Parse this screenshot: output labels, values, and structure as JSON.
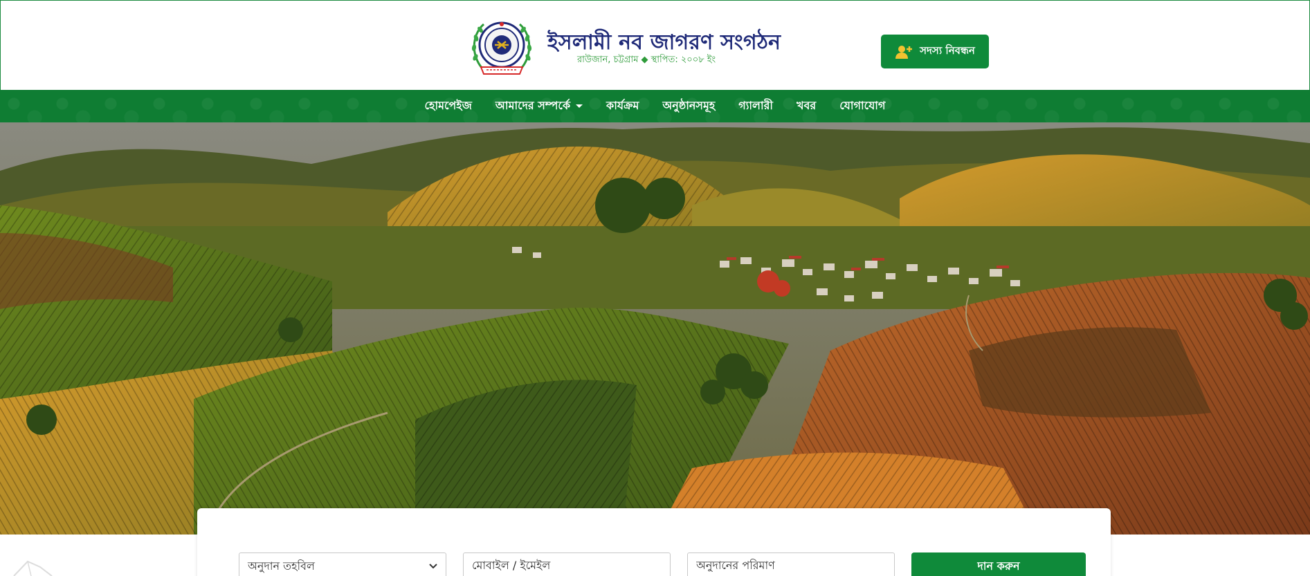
{
  "brand": {
    "title": "ইসলামী নব জাগরণ সংগঠন",
    "subtitle": "রাউজান, চট্টগ্রাম ◆ স্থাপিত: ২০০৮ ইং",
    "logo_ribbon": "স্থাপিত: ২০০৮ইং",
    "primary_color": "#0f8a3a",
    "title_color": "#1f2a78"
  },
  "header": {
    "register_label": "সদস্য নিবন্ধন",
    "register_icon": "user-plus-icon"
  },
  "nav": {
    "items": [
      {
        "label": "হোমপেইজ"
      },
      {
        "label": "আমাদের সম্পর্কে",
        "has_dropdown": true
      },
      {
        "label": "কার্যক্রম"
      },
      {
        "label": "অনুষ্ঠানসমূহ"
      },
      {
        "label": "গ্যালারী"
      },
      {
        "label": "খবর"
      },
      {
        "label": "যোগাযোগ"
      }
    ]
  },
  "donation": {
    "fund_select_value": "অনুদান তহবিল",
    "mobile_placeholder": "মোবাইল / ইমেইল",
    "amount_placeholder": "অনুদানের পরিমাণ",
    "donate_label": "দান করুন"
  }
}
